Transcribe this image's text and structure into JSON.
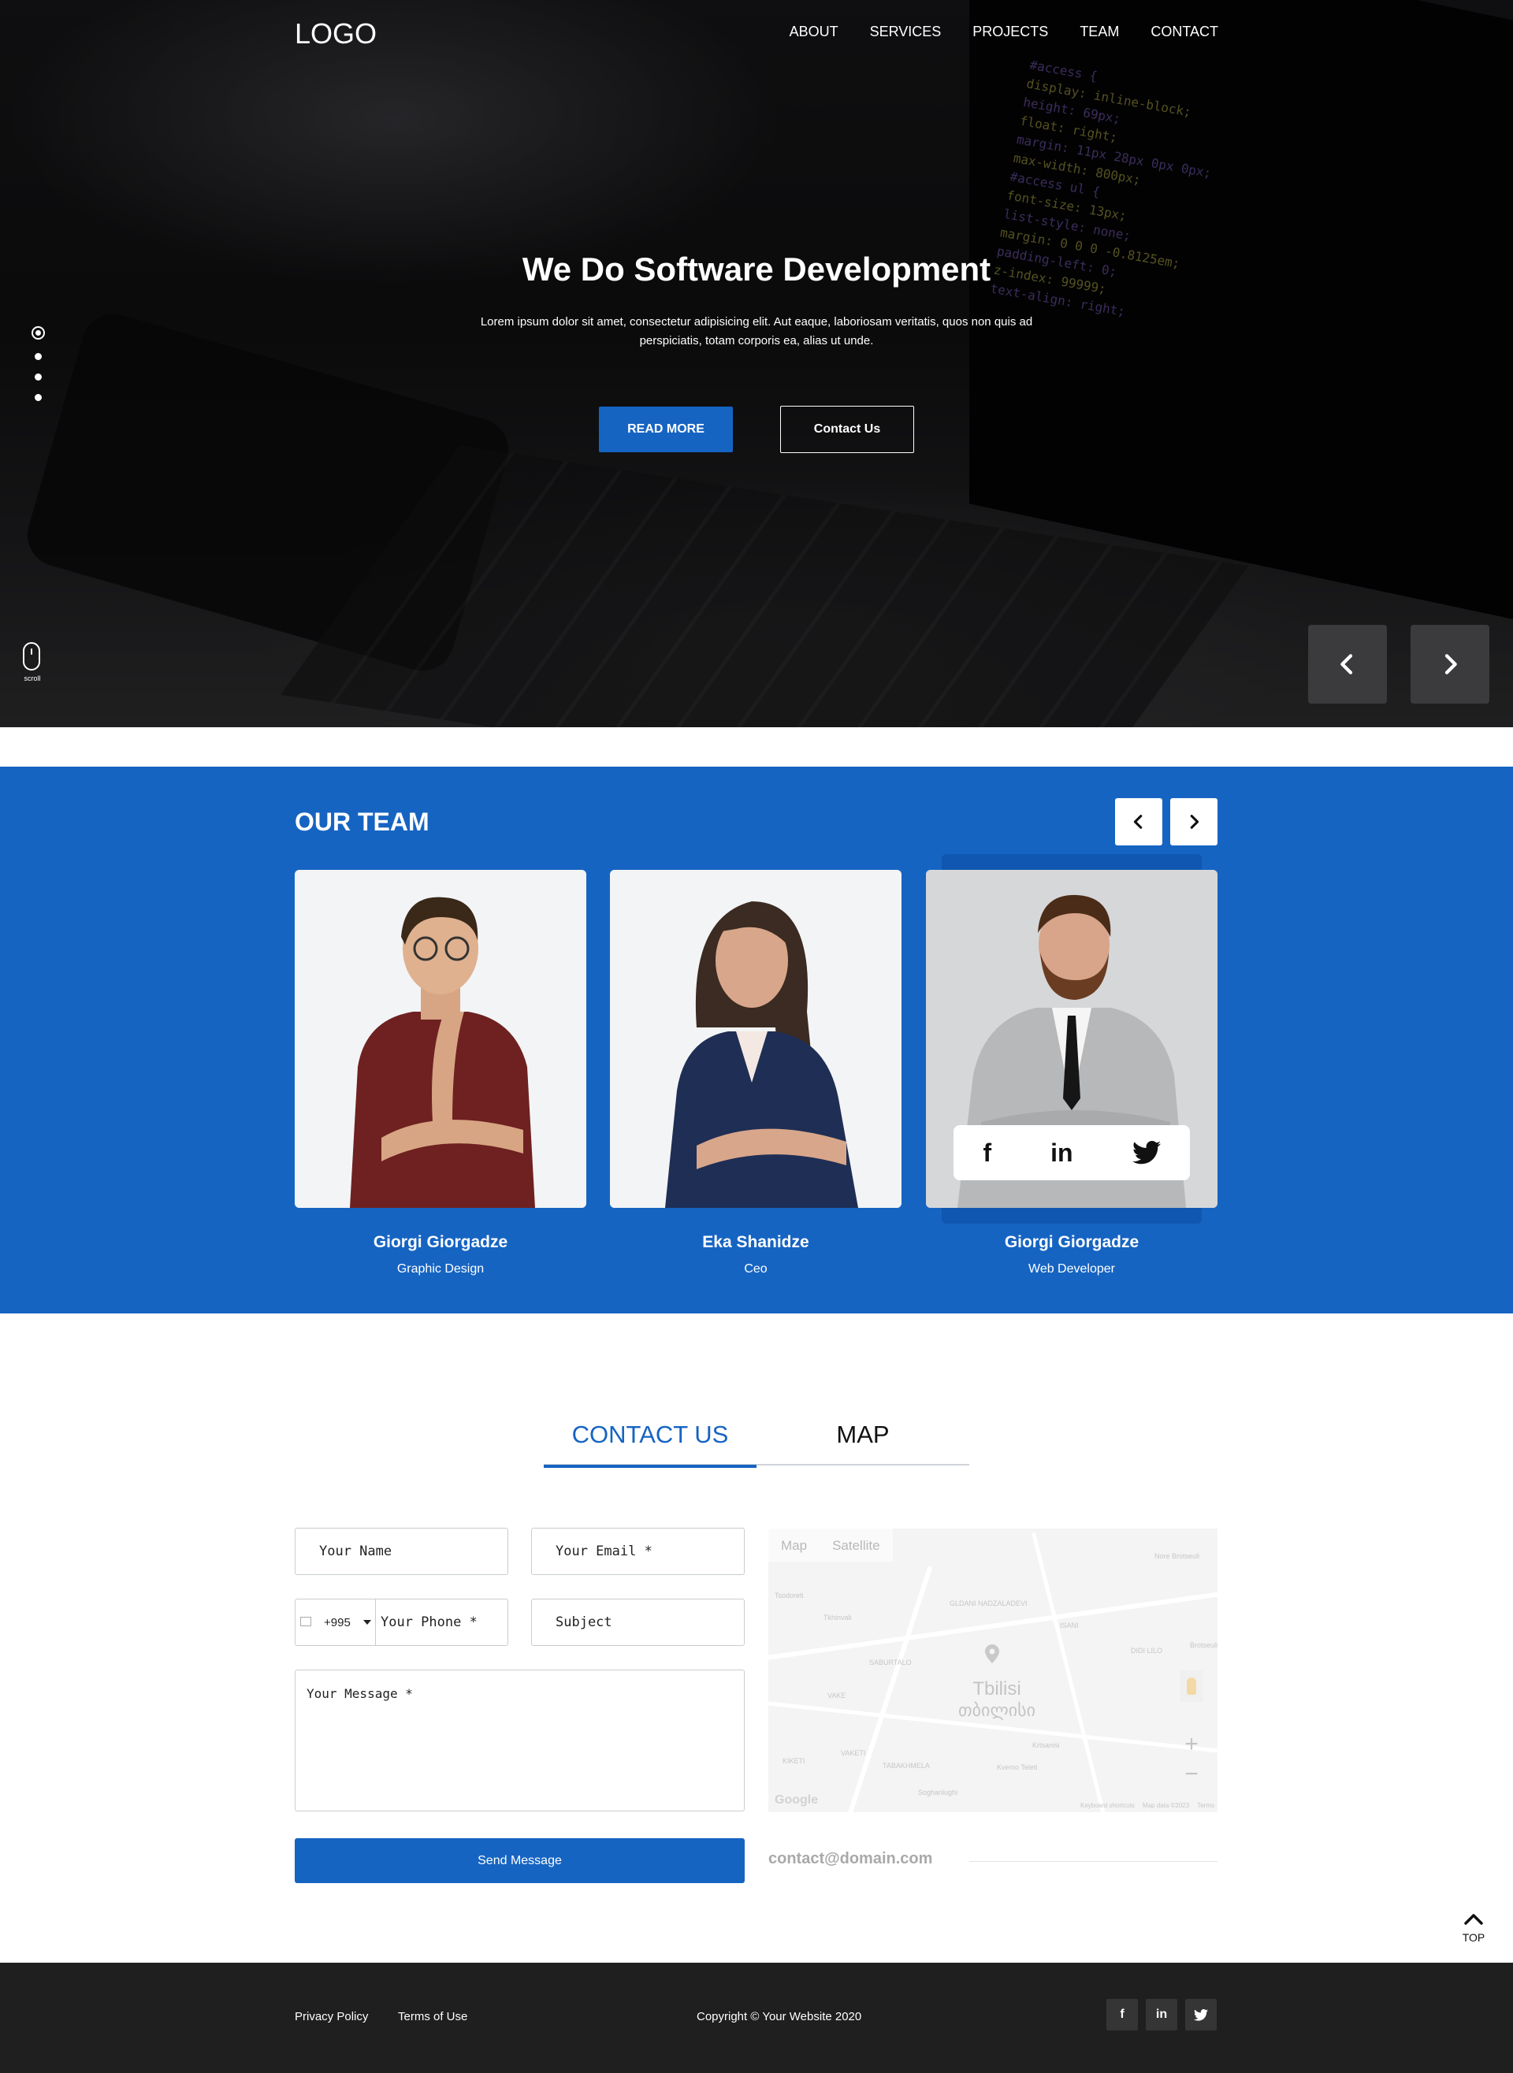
{
  "header": {
    "logo": "LOGO",
    "nav": [
      "ABOUT",
      "SERVICES",
      "PROJECTS",
      "TEAM",
      "CONTACT"
    ]
  },
  "hero": {
    "title": "We Do Software Development",
    "subtitle": "Lorem ipsum dolor sit amet, consectetur adipisicing elit. Aut eaque, laboriosam veritatis, quos non quis ad perspiciatis, totam corporis ea, alias ut unde.",
    "read_more": "READ MORE",
    "contact_us": "Contact Us",
    "scroll_label": "scroll",
    "slide_count": 4,
    "active_slide": 1,
    "code_lines": [
      "#access {",
      "display: inline-block;",
      "height: 69px;",
      "float: right;",
      "margin: 11px 28px 0px 0px;",
      "max-width: 800px;",
      "#access ul {",
      "font-size: 13px;",
      "list-style: none;",
      "margin: 0 0 0 -0.8125em;",
      "padding-left: 0;",
      "z-index: 99999;",
      "text-align: right;"
    ]
  },
  "team": {
    "title": "OUR TEAM",
    "members": [
      {
        "name": "Giorgi Giorgadze",
        "role": "Graphic Design"
      },
      {
        "name": "Eka Shanidze",
        "role": "Ceo"
      },
      {
        "name": "Giorgi Giorgadze",
        "role": "Web Developer"
      }
    ],
    "social": [
      "f",
      "in",
      "twitter-icon"
    ]
  },
  "contact": {
    "tabs": [
      "CONTACT US",
      "MAP"
    ],
    "active_tab": "CONTACT US",
    "name_placeholder": "Your Name",
    "email_placeholder": "Your Email *",
    "phone_prefix": "+995",
    "phone_placeholder": "Your Phone *",
    "subject_placeholder": "Subject",
    "message_placeholder": "Your Message *",
    "send_label": "Send Message",
    "email": "contact@domain.com"
  },
  "map": {
    "type_map": "Map",
    "type_satellite": "Satellite",
    "city_en": "Tbilisi",
    "city_ka": "თბილისი",
    "labels": [
      "Tsodoreti",
      "Tkhinvali",
      "SABURTALO",
      "VAKE",
      "VAKETI",
      "KIKETI",
      "DIDI LILO",
      "GLDANI NADZALADEVI",
      "ISANI",
      "TABAKHMELA",
      "Krtsanisi",
      "Soghanlughi",
      "Kvemo Teleti",
      "Nore Brotseuli",
      "Brotseuli"
    ],
    "footer": [
      "Keyboard shortcuts",
      "Map data ©2023",
      "Terms"
    ],
    "brand": "Google"
  },
  "top_label": "TOP",
  "footer": {
    "links": [
      "Privacy Policy",
      "Terms of Use"
    ],
    "copyright": "Copyright © Your Website 2020",
    "social": [
      "f",
      "in",
      "twitter-icon"
    ]
  },
  "colors": {
    "accent": "#1664c2",
    "footer_bg": "#1f1f1f"
  }
}
